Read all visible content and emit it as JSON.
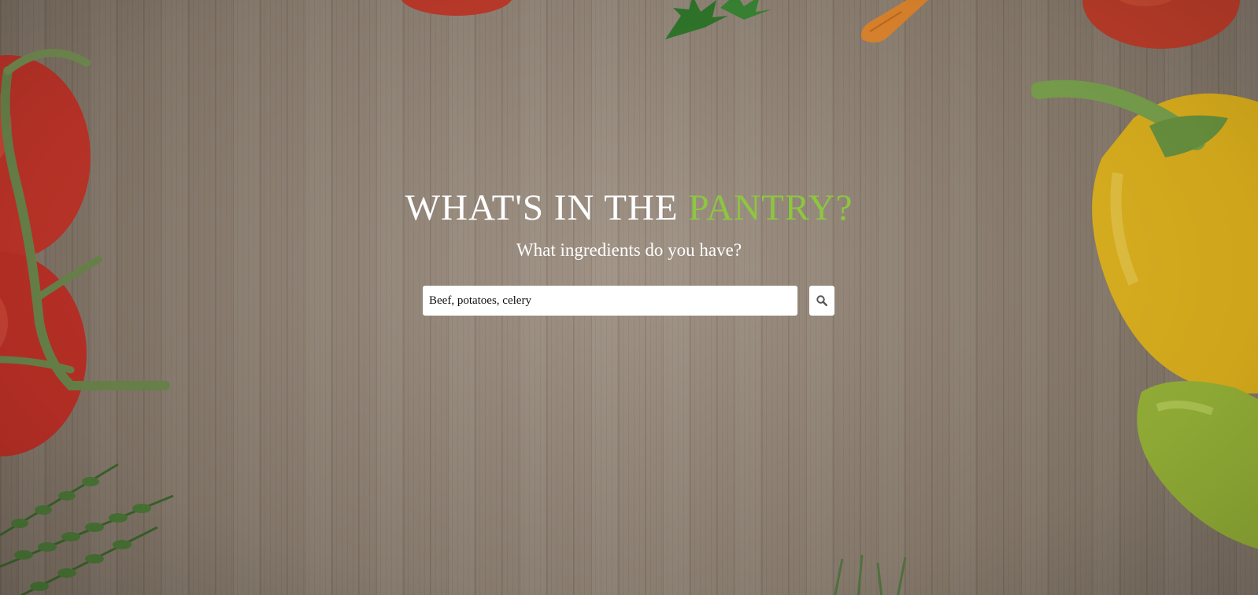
{
  "hero": {
    "title_main": "WHAT'S IN THE ",
    "title_accent": "PANTRY?",
    "subtitle": "What ingredients do you have?"
  },
  "search": {
    "value": "Beef, potatoes, celery",
    "button_icon": "search-icon"
  },
  "colors": {
    "accent": "#8dc63f",
    "text": "#ffffff",
    "wood": "#938577"
  }
}
